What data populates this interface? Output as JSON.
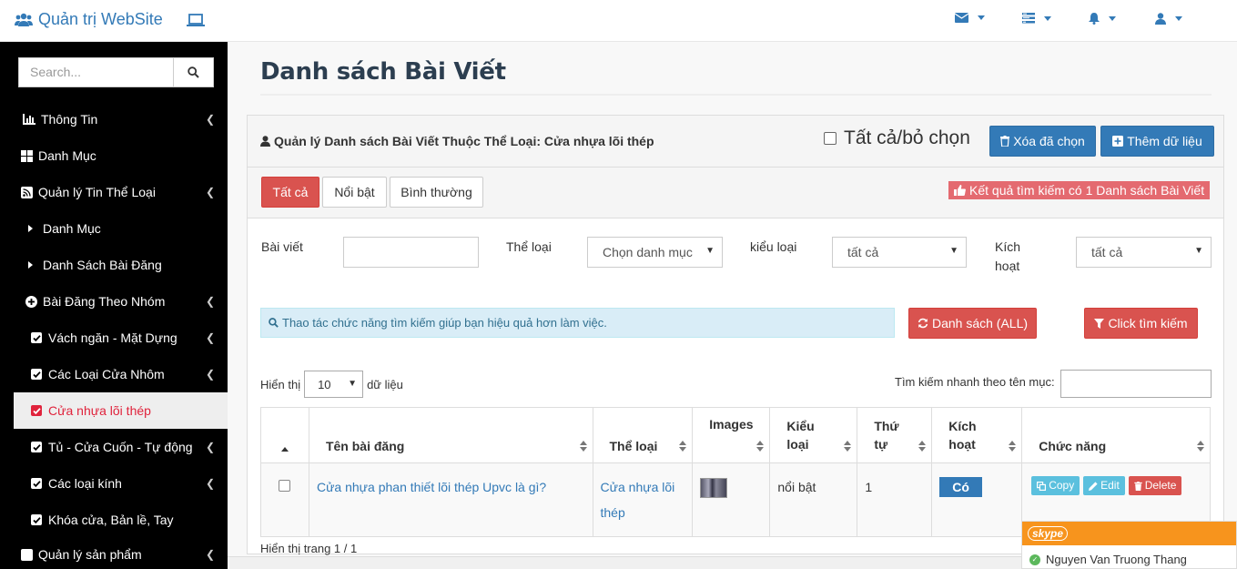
{
  "navbar": {
    "brand": "Quản trị WebSite"
  },
  "sidebar": {
    "search_placeholder": "Search...",
    "items": [
      {
        "label": "Thông Tin"
      },
      {
        "label": "Danh Mục"
      },
      {
        "label": "Quản lý Tin Thể Loại"
      },
      {
        "label": "Danh Mục"
      },
      {
        "label": "Danh Sách Bài Đăng"
      },
      {
        "label": "Bài Đăng Theo Nhóm"
      },
      {
        "label": "Vách ngăn - Mặt Dựng"
      },
      {
        "label": "Các Loại Cửa Nhôm"
      },
      {
        "label": "Cửa nhựa lõi thép"
      },
      {
        "label": "Tủ - Cửa Cuốn - Tự động"
      },
      {
        "label": "Các loại kính"
      },
      {
        "label": "Khóa cửa, Bản lề, Tay"
      },
      {
        "label": "Quản lý sản phẩm"
      }
    ]
  },
  "page": {
    "title": "Danh sách Bài Viết"
  },
  "panel": {
    "heading": "Quản lý Danh sách Bài Viết Thuộc Thể Loại: Cửa nhựa lõi thép",
    "select_all": "Tất cả/bỏ chọn",
    "delete_selected": "Xóa đã chọn",
    "add_data": "Thêm dữ liệu"
  },
  "tabs": [
    {
      "label": "Tất cả"
    },
    {
      "label": "Nổi bật"
    },
    {
      "label": "Bình thường"
    }
  ],
  "result_badge": "Kết quả tìm kiếm có 1 Danh sách Bài Viết",
  "filters": {
    "article_label": "Bài viết",
    "category_label": "Thể loại",
    "category_value": "Chọn danh mục",
    "type_label": "kiểu loại",
    "type_value": "tất cả",
    "active_label_1": "Kích",
    "active_label_2": "hoạt",
    "active_value": "tất cả"
  },
  "info_text": "Thao tác chức năng tìm kiếm giúp bạn hiệu quả hơn làm việc.",
  "btn_list_all": "Danh sách (ALL)",
  "btn_search": "Click tìm kiếm",
  "table_controls": {
    "show_prefix": "Hiển thị",
    "page_length": "10",
    "show_suffix": "dữ liệu",
    "quick_search": "Tìm kiếm nhanh theo tên mục:"
  },
  "table": {
    "headers": {
      "name": "Tên bài đăng",
      "category": "Thể loại",
      "images": "Images",
      "type_1": "Kiểu",
      "type_2": "loại",
      "order_1": "Thứ",
      "order_2": "tự",
      "active_1": "Kích",
      "active_2": "hoạt",
      "actions": "Chức năng"
    },
    "rows": [
      {
        "name": "Cửa nhựa phan thiết lõi thép Upvc là gì?",
        "category_1": "Cửa nhựa lõi",
        "category_2": "thép",
        "type": "nổi bật",
        "order": "1",
        "active": "Có",
        "copy": "Copy",
        "edit": "Edit",
        "delete": "Delete"
      }
    ]
  },
  "page_info": "Hiển thị trang 1 / 1",
  "skype": {
    "logo": "skype",
    "contact": "Nguyen Van Truong Thang"
  },
  "colors": {
    "primary": "#337ab7",
    "danger": "#d9534f",
    "info": "#5bc0de",
    "sidebar_bg": "#000000",
    "active_item": "#e0233c",
    "skype_orange": "#f7941d"
  }
}
